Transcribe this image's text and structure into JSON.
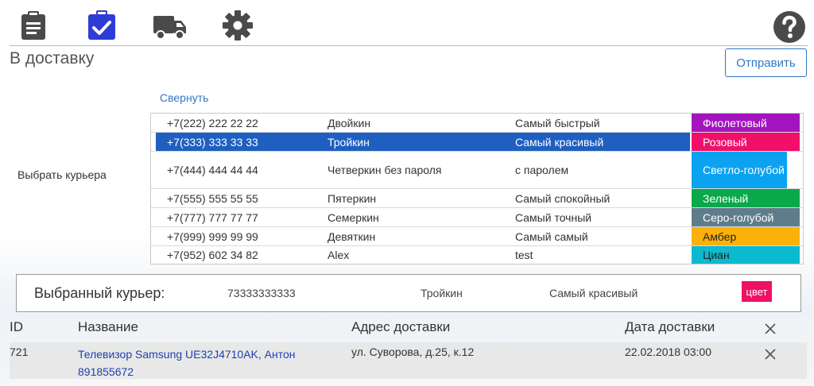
{
  "nav": {
    "icons": [
      "clipboard-icon",
      "clipboard-check-icon",
      "truck-icon",
      "gear-icon"
    ],
    "active": "clipboard-check-icon",
    "help_icon": "help-icon",
    "active_color": "#2f3bd6",
    "icon_color": "#4a4a4a"
  },
  "page": {
    "title": "В доставку",
    "send_label": "Отправить",
    "collapse_label": "Свернуть",
    "choose_courier_label": "Выбрать курьера"
  },
  "couriers": [
    {
      "phone": "+7(222) 222 22 22",
      "name": "Двойкин",
      "desc": "Самый быстрый",
      "color_label": "Фиолетовый",
      "color": "#a314bf",
      "selected": false
    },
    {
      "phone": "+7(333) 333 33 33",
      "name": "Тройкин",
      "desc": "Самый красивый",
      "color_label": "Розовый",
      "color": "#f0106a",
      "selected": true
    },
    {
      "phone": "+7(444) 444 44 44",
      "name": "Четверкин без пароля",
      "desc": "с паролем",
      "color_label": "Светло-голубой",
      "color": "#0ba3f0",
      "selected": false
    },
    {
      "phone": "+7(555) 555 55 55",
      "name": "Пятеркин",
      "desc": "Самый спокойный",
      "color_label": "Зеленый",
      "color": "#0aa84a",
      "selected": false
    },
    {
      "phone": "+7(777) 777 77 77",
      "name": "Семеркин",
      "desc": "Самый точный",
      "color_label": "Серо-голубой",
      "color": "#5f7c8b",
      "selected": false
    },
    {
      "phone": "+7(999) 999 99 99",
      "name": "Девяткин",
      "desc": "Самый самый",
      "color_label": "Амбер",
      "color": "#fbb10a",
      "selected": false
    },
    {
      "phone": "+7(952) 602 34 82",
      "name": "Alex",
      "desc": "test",
      "color_label": "Циан",
      "color": "#0cbad0",
      "selected": false
    }
  ],
  "selected_courier": {
    "label": "Выбранный курьер:",
    "phone": "73333333333",
    "name": "Тройкин",
    "desc": "Самый красивый",
    "color_label": "цвет",
    "color": "#ee1166"
  },
  "orders": {
    "headers": {
      "id": "ID",
      "name": "Название",
      "address": "Адрес доставки",
      "date": "Дата доставки"
    },
    "rows": [
      {
        "id": "721",
        "name": "Телевизор Samsung UE32J4710AK, Антон 891855672",
        "address": "ул. Суворова, д.25, к.12",
        "date": "22.02.2018 03:00"
      }
    ]
  }
}
